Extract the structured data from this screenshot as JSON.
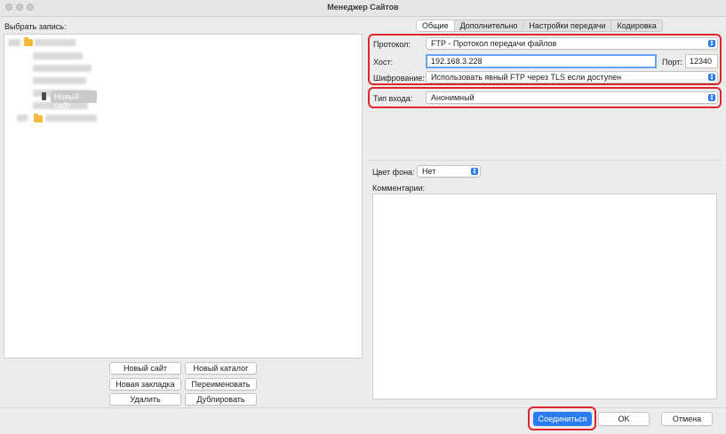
{
  "window": {
    "title": "Менеджер Сайтов"
  },
  "left": {
    "select_label": "Выбрать запись:",
    "tree": {
      "selected_site": "Новый сайт"
    },
    "buttons": {
      "new_site": "Новый сайт",
      "new_folder": "Новый каталог",
      "new_bookmark": "Новая закладка",
      "rename": "Переименовать",
      "delete": "Удалить",
      "duplicate": "Дублировать"
    }
  },
  "tabs": [
    {
      "label": "Общие",
      "active": true
    },
    {
      "label": "Дополнительно",
      "active": false
    },
    {
      "label": "Настройки передачи",
      "active": false
    },
    {
      "label": "Кодировка",
      "active": false
    }
  ],
  "form": {
    "protocol_label": "Протокол:",
    "protocol_value": "FTP - Протокол передачи файлов",
    "host_label": "Хост:",
    "host_value": "192.168.3.228",
    "port_label": "Порт:",
    "port_value": "12340",
    "encryption_label": "Шифрование:",
    "encryption_value": "Использовать явный FTP через TLS если доступен",
    "logon_label": "Тип входа:",
    "logon_value": "Анонимный",
    "bg_label": "Цвет фона:",
    "bg_value": "Нет",
    "comments_label": "Комментарии:"
  },
  "footer": {
    "connect": "Соединиться",
    "ok": "OK",
    "cancel": "Отмена"
  },
  "colors": {
    "highlight": "#e0262b",
    "accent": "#2b7cf0",
    "folder": "#f5b93b"
  }
}
